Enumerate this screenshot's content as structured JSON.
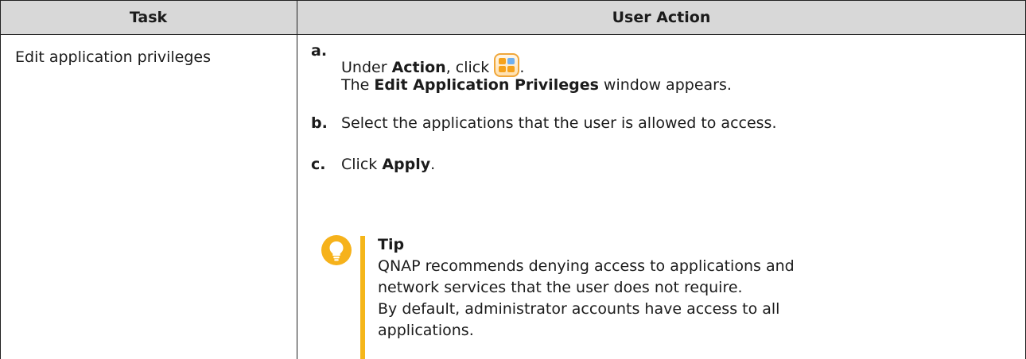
{
  "table": {
    "headers": {
      "task": "Task",
      "action": "User Action"
    },
    "task": "Edit application privileges",
    "steps": {
      "a": {
        "letter": "a.",
        "pre": "Under ",
        "bold1": "Action",
        "mid": ", click",
        "post": ".",
        "line2_pre": "The ",
        "line2_bold": "Edit Application Privileges",
        "line2_post": " window appears."
      },
      "b": {
        "letter": "b.",
        "text": "Select the applications that the user is allowed to access."
      },
      "c": {
        "letter": "c.",
        "pre": "Click ",
        "bold": "Apply",
        "post": "."
      }
    },
    "tip": {
      "title": "Tip",
      "lines": [
        "QNAP recommends denying access to applications and",
        "network services that the user does not require.",
        "By default, administrator accounts have access to all",
        "applications."
      ]
    }
  },
  "icons": {
    "step_icon": "application-privileges-icon",
    "tip_icon": "lightbulb-icon"
  },
  "colors": {
    "header_bg": "#d8d8d8",
    "tip_accent": "#f5b61a",
    "icon_border": "#f0a73a"
  }
}
